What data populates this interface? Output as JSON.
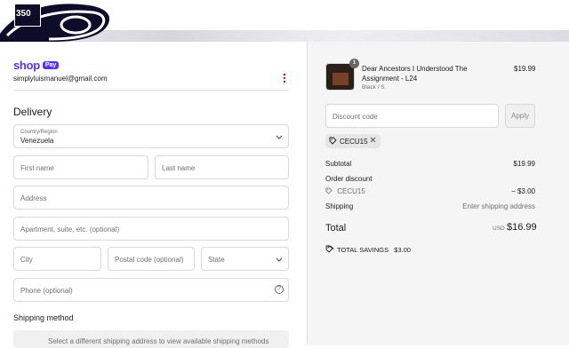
{
  "header": {
    "logo_icon": "store-logo",
    "logo_text": "350"
  },
  "contact": {
    "brand": "shop",
    "brand_badge": "Pay",
    "email": "simplyluismanuel@gmail.com",
    "menu_icon": "vertical-dots-icon"
  },
  "delivery": {
    "title": "Delivery",
    "country_label": "Country/Region",
    "country_value": "Venezuela",
    "first_name_placeholder": "First name",
    "last_name_placeholder": "Last name",
    "address_placeholder": "Address",
    "apartment_placeholder": "Apartment, suite, etc. (optional)",
    "city_placeholder": "City",
    "postal_placeholder": "Postal code (optional)",
    "state_placeholder": "State",
    "phone_placeholder": "Phone (optional)"
  },
  "shipping": {
    "title": "Shipping method",
    "message": "Select a different shipping address to view available shipping methods"
  },
  "cart": {
    "item": {
      "quantity": "1",
      "title": "Dear Ancestors I Understood The Assignment - L24",
      "variant": "Black / S",
      "price": "$19.99"
    },
    "discount_placeholder": "Discount code",
    "apply_label": "Apply",
    "applied_code": "CECU15",
    "subtotal_label": "Subtotal",
    "subtotal_value": "$19.99",
    "order_discount_label": "Order discount",
    "discount_code": "CECU15",
    "discount_value": "− $3.00",
    "shipping_label": "Shipping",
    "shipping_value": "Enter shipping address",
    "total_label": "Total",
    "currency": "USD",
    "total_value": "$16.99",
    "savings_label": "TOTAL SAVINGS",
    "savings_value": "$3.00"
  },
  "colors": {
    "shop_purple": "#5a31f4",
    "menu_red": "#c8102e"
  }
}
